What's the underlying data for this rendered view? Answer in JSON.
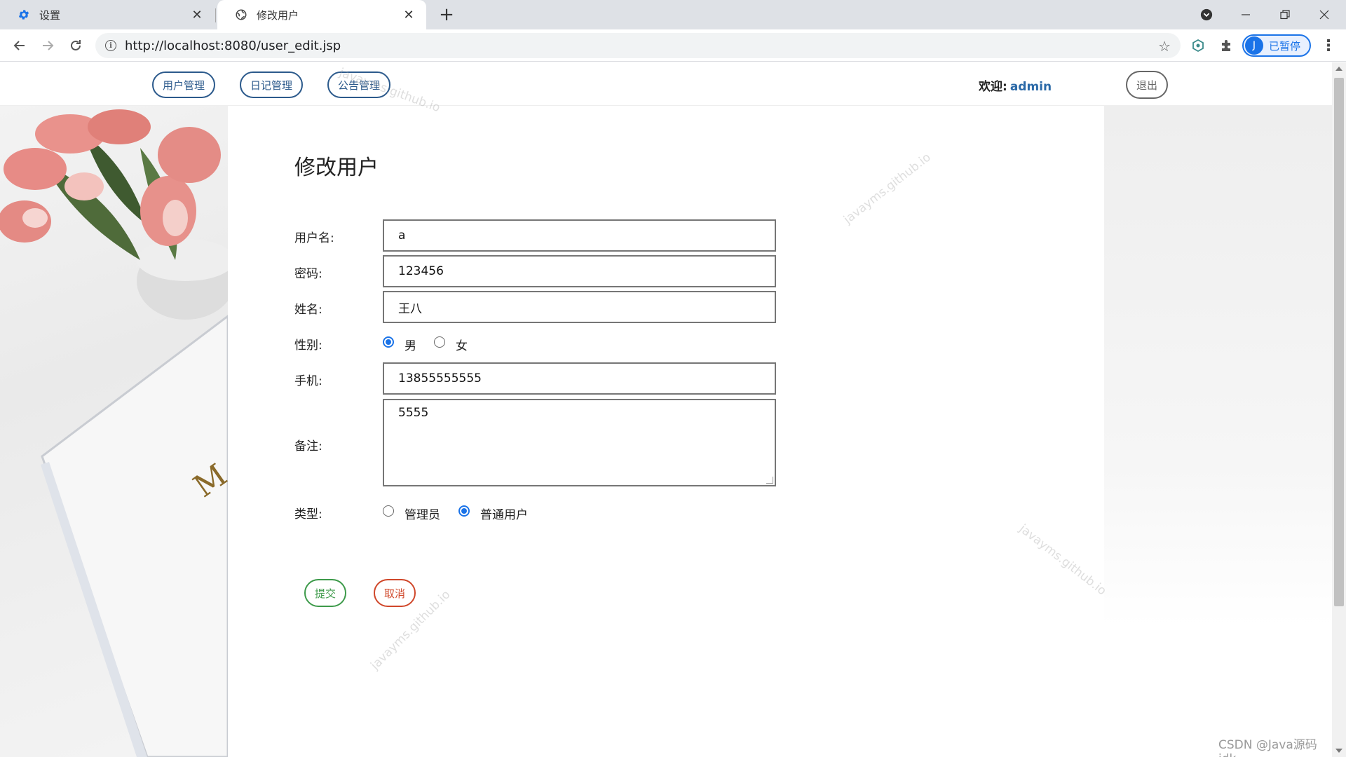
{
  "browser": {
    "tabs": [
      {
        "label": "设置",
        "icon": "gear-icon"
      },
      {
        "label": "修改用户",
        "icon": "globe-icon"
      }
    ],
    "url": "http://localhost:8080/user_edit.jsp",
    "profile_initial": "J",
    "profile_status": "已暂停"
  },
  "nav": {
    "items": [
      "用户管理",
      "日记管理",
      "公告管理"
    ],
    "welcome_label": "欢迎:",
    "username": "admin",
    "logout": "退出"
  },
  "form": {
    "title": "修改用户",
    "username_label": "用户名:",
    "username_value": "a",
    "password_label": "密码:",
    "password_value": "123456",
    "realname_label": "姓名:",
    "realname_value": "王八",
    "gender_label": "性别:",
    "gender_options": [
      "男",
      "女"
    ],
    "gender_selected": "男",
    "phone_label": "手机:",
    "phone_value": "13855555555",
    "note_label": "备注:",
    "note_value": "5555",
    "type_label": "类型:",
    "type_options": [
      "管理员",
      "普通用户"
    ],
    "type_selected": "普通用户",
    "submit": "提交",
    "cancel": "取消"
  },
  "watermarks": [
    "javayms.github.io",
    "CSDN @Java源码jdk"
  ],
  "colors": {
    "nav_border": "#2c5a8c",
    "submit": "#3d9a4a",
    "cancel": "#d0472a",
    "radio_selected": "#1a73e8"
  }
}
